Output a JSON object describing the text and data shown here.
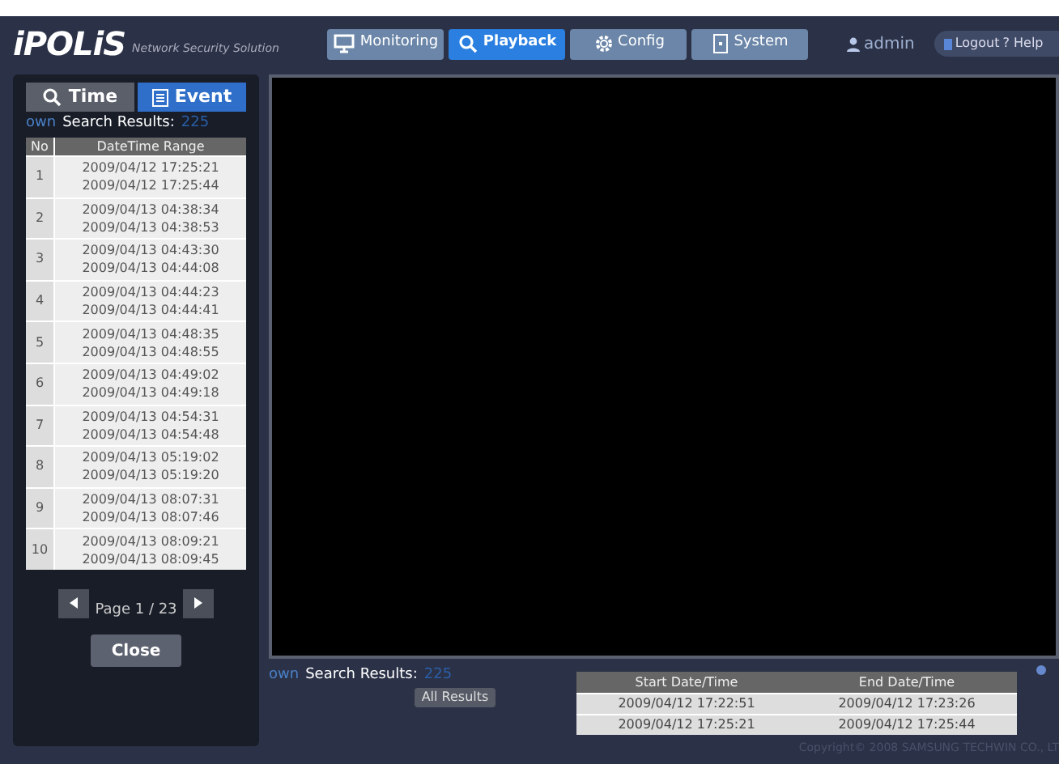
{
  "header": {
    "logo": "iPOLiS",
    "tagline": "Network Security Solution",
    "nav": [
      {
        "label": "Monitoring",
        "kind": "monitor",
        "selected": false
      },
      {
        "label": "Playback",
        "kind": "search",
        "selected": true
      },
      {
        "label": "Config",
        "kind": "gear",
        "selected": false
      },
      {
        "label": "System",
        "kind": "device",
        "selected": false
      }
    ],
    "user": "admin",
    "logout": "Logout",
    "help": "? Help"
  },
  "sidebar": {
    "tabs": [
      {
        "label": "Time",
        "kind": "search",
        "selected": false
      },
      {
        "label": "Event",
        "kind": "list",
        "selected": true
      }
    ],
    "prefix": "own",
    "results_label": "Search Results:",
    "results_count": "225",
    "columns": [
      "No",
      "DateTime Range"
    ],
    "rows": [
      {
        "no": "1",
        "start": "2009/04/12 17:25:21",
        "end": "2009/04/12 17:25:44"
      },
      {
        "no": "2",
        "start": "2009/04/13 04:38:34",
        "end": "2009/04/13 04:38:53"
      },
      {
        "no": "3",
        "start": "2009/04/13 04:43:30",
        "end": "2009/04/13 04:44:08"
      },
      {
        "no": "4",
        "start": "2009/04/13 04:44:23",
        "end": "2009/04/13 04:44:41"
      },
      {
        "no": "5",
        "start": "2009/04/13 04:48:35",
        "end": "2009/04/13 04:48:55"
      },
      {
        "no": "6",
        "start": "2009/04/13 04:49:02",
        "end": "2009/04/13 04:49:18"
      },
      {
        "no": "7",
        "start": "2009/04/13 04:54:31",
        "end": "2009/04/13 04:54:48"
      },
      {
        "no": "8",
        "start": "2009/04/13 05:19:02",
        "end": "2009/04/13 05:19:20"
      },
      {
        "no": "9",
        "start": "2009/04/13 08:07:31",
        "end": "2009/04/13 08:07:46"
      },
      {
        "no": "10",
        "start": "2009/04/13 08:09:21",
        "end": "2009/04/13 08:09:45"
      }
    ],
    "page": "Page 1 / 23",
    "close": "Close"
  },
  "results": {
    "prefix": "own",
    "label": "Search Results:",
    "count": "225",
    "all_button": "All Results",
    "columns": [
      "Start Date/Time",
      "End Date/Time"
    ],
    "rows": [
      [
        "2009/04/12 17:22:51",
        "2009/04/12 17:23:26"
      ],
      [
        "2009/04/12 17:25:21",
        "2009/04/12 17:25:44"
      ]
    ]
  },
  "footer": "Copyright© 2008 SAMSUNG TECHWIN CO., LT"
}
